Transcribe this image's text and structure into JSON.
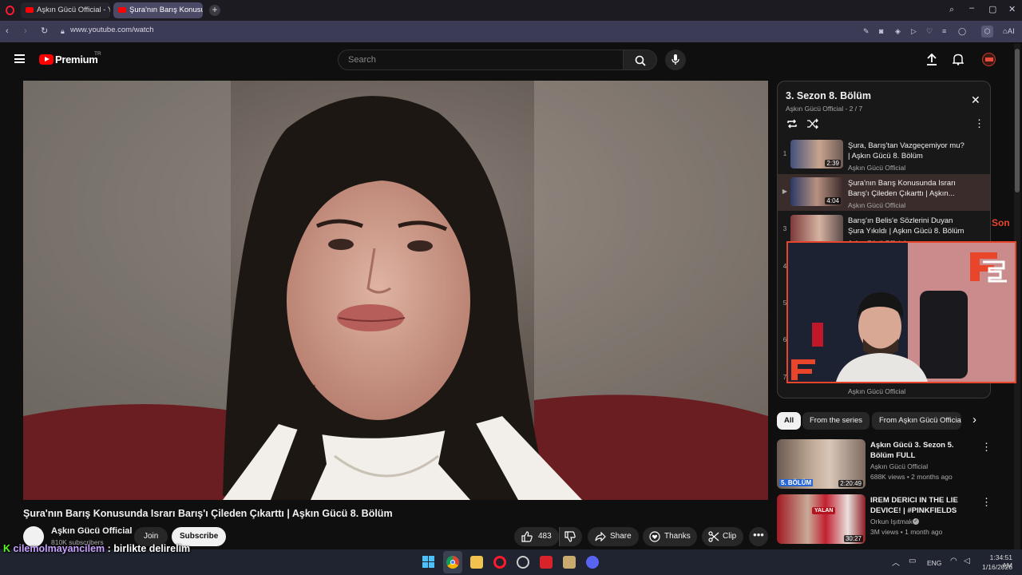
{
  "browser": {
    "tabs": [
      {
        "label": "Aşkın Gücü Official - YouTube"
      },
      {
        "label": "Şura'nın Barış Konusunda Israrı"
      }
    ],
    "url": "www.youtube.com/watch",
    "ai_label": "AI"
  },
  "header": {
    "logo_text": "Premium",
    "region_badge": "TR",
    "search_placeholder": "Search"
  },
  "video": {
    "title": "Şura'nın Barış Konusunda Israrı Barış'ı Çileden Çıkarttı | Aşkın Gücü 8. Bölüm",
    "channel": "Aşkın Gücü Official",
    "subscribers": "810K subscribers",
    "join_label": "Join",
    "subscribe_label": "Subscribe",
    "likes": "483",
    "share_label": "Share",
    "thanks_label": "Thanks",
    "clip_label": "Clip"
  },
  "playlist": {
    "title": "3. Sezon 8. Bölüm",
    "subtitle": "Aşkın Gücü Official - 2 / 7",
    "items": [
      {
        "index": "1",
        "title": "Şura, Barış'tan Vazgeçemiyor mu? | Aşkın Gücü 8. Bölüm",
        "channel": "Aşkın Gücü Official",
        "duration": "2:39"
      },
      {
        "index": "▶",
        "title": "Şura'nın Barış Konusunda Israrı Barış'ı Çileden Çıkarttı | Aşkın...",
        "channel": "Aşkın Gücü Official",
        "duration": "4:04"
      },
      {
        "index": "3",
        "title": "Barış'ın Belis'e Sözlerini Duyan Şura Yıkıldı | Aşkın Gücü 8. Bölüm",
        "channel": "Aşkın Gücü Official",
        "duration": ""
      },
      {
        "index": "4",
        "title": "",
        "channel": "",
        "duration": ""
      },
      {
        "index": "5",
        "title": "",
        "channel": "",
        "duration": ""
      },
      {
        "index": "6",
        "title": "",
        "channel": "",
        "duration": ""
      },
      {
        "index": "7",
        "title": "",
        "channel": "Aşkın Gücü Official",
        "duration": ""
      }
    ]
  },
  "chips": [
    "All",
    "From the series",
    "From Aşkın Gücü Official"
  ],
  "recommendations": [
    {
      "title": "Aşkın Gücü 3. Sezon 5. Bölüm FULL",
      "channel": "Aşkın Gücü Official",
      "meta": "688K views • 2 months ago",
      "duration": "2:20:49",
      "badge": "5. BÖLÜM"
    },
    {
      "title": "IREM DERICI IN THE LIE DEVICE! | #PINKFIELDS",
      "channel": "Orkun Işıtmak",
      "meta": "3M views • 1 month ago",
      "duration": "30:27",
      "badge": "YALAN"
    }
  ],
  "overlay": {
    "chat_user": "cilemolmayancilem",
    "chat_message": ": birlikte delirelim",
    "side_text": "Son"
  },
  "taskbar": {
    "lang": "ENG",
    "time": "1:34:51 AM",
    "date": "1/16/2026"
  },
  "colors": {
    "accent_red": "#ff0000",
    "streamer_orange": "#e8452a",
    "chat_user_color": "#c8a2ff"
  }
}
